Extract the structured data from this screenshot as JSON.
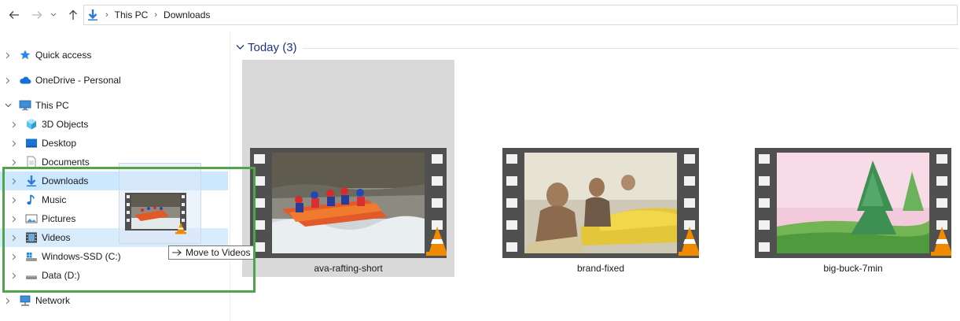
{
  "address_bar": {
    "segments": [
      "This PC",
      "Downloads"
    ]
  },
  "nav_pane": {
    "items": [
      {
        "label": "Quick access",
        "icon": "star-icon"
      },
      {
        "label": "OneDrive - Personal",
        "icon": "cloud-icon"
      },
      {
        "label": "This PC",
        "icon": "computer-icon"
      },
      {
        "label": "3D Objects",
        "icon": "cube-icon"
      },
      {
        "label": "Desktop",
        "icon": "desktop-icon"
      },
      {
        "label": "Documents",
        "icon": "document-icon"
      },
      {
        "label": "Downloads",
        "icon": "download-arrow-icon"
      },
      {
        "label": "Music",
        "icon": "music-note-icon"
      },
      {
        "label": "Pictures",
        "icon": "picture-icon"
      },
      {
        "label": "Videos",
        "icon": "film-icon"
      },
      {
        "label": "Windows-SSD (C:)",
        "icon": "windows-drive-icon"
      },
      {
        "label": "Data (D:)",
        "icon": "drive-icon"
      },
      {
        "label": "Network",
        "icon": "network-icon"
      }
    ]
  },
  "content": {
    "group_title": "Today (3)",
    "files": [
      {
        "name": "ava-rafting-short"
      },
      {
        "name": "brand-fixed"
      },
      {
        "name": "big-buck-7min"
      }
    ]
  },
  "drag": {
    "tooltip": "Move to Videos"
  },
  "colors": {
    "selection": "#cce8ff",
    "hover": "#d9ecfb",
    "group_title": "#1e3287",
    "annotation_box": "#4fa54a",
    "vlc_orange": "#f08a00"
  }
}
